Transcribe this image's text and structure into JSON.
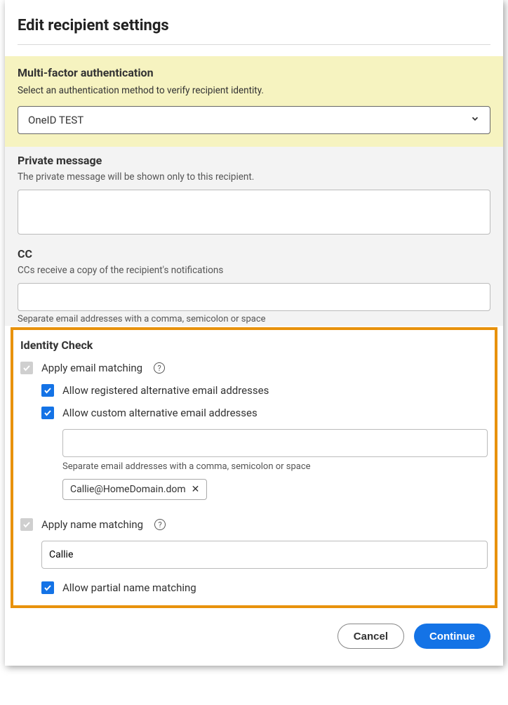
{
  "dialog": {
    "title": "Edit recipient settings"
  },
  "mfa": {
    "title": "Multi-factor authentication",
    "subtitle": "Select an authentication method to verify recipient identity.",
    "selected": "OneID TEST"
  },
  "privateMessage": {
    "title": "Private message",
    "subtitle": "The private message will be shown only to this recipient.",
    "value": ""
  },
  "cc": {
    "title": "CC",
    "subtitle": "CCs receive a copy of the recipient's notifications",
    "value": "",
    "helper": "Separate email addresses with a comma, semicolon or space"
  },
  "identity": {
    "title": "Identity Check",
    "emailMatching": {
      "label": "Apply email matching",
      "allowRegistered": "Allow registered alternative email addresses",
      "allowCustom": "Allow custom alternative email addresses",
      "customValue": "",
      "customHelper": "Separate email addresses with a comma, semicolon or space",
      "chip": "Callie@HomeDomain.dom"
    },
    "nameMatching": {
      "label": "Apply name matching",
      "value": "Callie",
      "allowPartial": "Allow partial name matching"
    }
  },
  "footer": {
    "cancel": "Cancel",
    "continue": "Continue"
  }
}
